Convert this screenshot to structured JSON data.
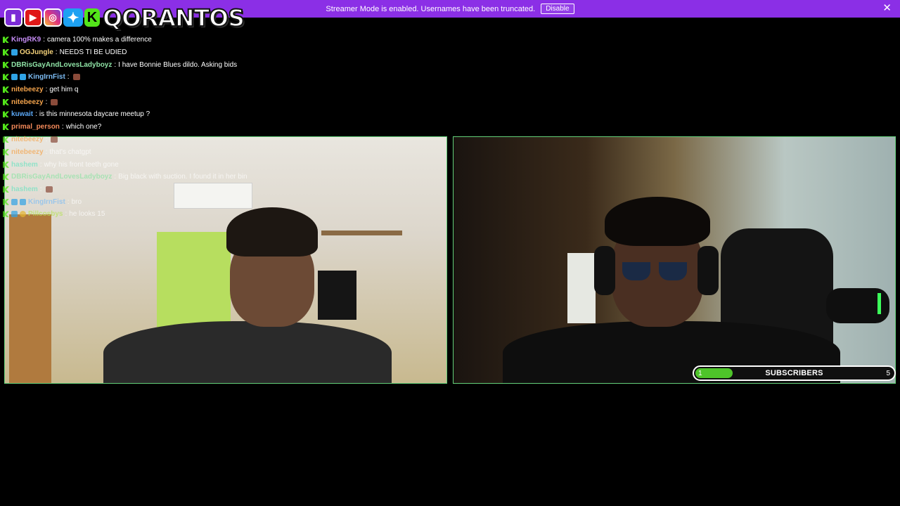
{
  "banner": {
    "message": "Streamer Mode is enabled. Usernames have been truncated.",
    "button_label": "Disable",
    "close_glyph": "✕",
    "color": "#8b2fe6"
  },
  "logo": {
    "name": "QORANTOS",
    "icons": [
      "twitch-icon",
      "youtube-icon",
      "instagram-icon",
      "twitter-icon",
      "kick-icon"
    ]
  },
  "chat_top": [
    {
      "user": "KingRK9",
      "color": "#c58cf5",
      "badges": [
        "kick"
      ],
      "text": "camera 100% makes a difference"
    },
    {
      "user": "OGJungle",
      "color": "#f5d27a",
      "badges": [
        "kick",
        "blue"
      ],
      "text": "NEEDS TI BE UDIED"
    },
    {
      "user": "DBRisGayAndLovesLadyboyz",
      "color": "#8fe3a6",
      "badges": [
        "kick"
      ],
      "text": "I have Bonnie Blues dildo. Asking bids"
    },
    {
      "user": "KingIrnFist",
      "color": "#7dbdf5",
      "badges": [
        "kick",
        "blue",
        "blue"
      ],
      "text": "",
      "emote": true
    },
    {
      "user": "nitebeezy",
      "color": "#f5a44c",
      "badges": [
        "kick"
      ],
      "text": "get him q"
    },
    {
      "user": "nitebeezy",
      "color": "#f5a44c",
      "badges": [
        "kick"
      ],
      "text": "",
      "emote": true
    },
    {
      "user": "kuwait",
      "color": "#5aa7f5",
      "badges": [
        "kick"
      ],
      "text": "is this minnesota daycare meetup ?"
    },
    {
      "user": "primal_person",
      "color": "#f58a5a",
      "badges": [
        "kick"
      ],
      "text": "which one?"
    }
  ],
  "chat_over": [
    {
      "user": "nitebeezy",
      "color": "#f5a44c",
      "badges": [
        "kick"
      ],
      "text": "",
      "emote": true
    },
    {
      "user": "nitebeezy",
      "color": "#f5a44c",
      "badges": [
        "kick"
      ],
      "text": "that's chatgpt"
    },
    {
      "user": "hashem",
      "color": "#6fe3c2",
      "badges": [
        "kick"
      ],
      "text": "why his front teeth gone"
    },
    {
      "user": "DBRisGayAndLovesLadyboyz",
      "color": "#8fe3a6",
      "badges": [
        "kick"
      ],
      "text": "Big black with suction. I found it in her bin"
    },
    {
      "user": "hashem",
      "color": "#6fe3c2",
      "badges": [
        "kick"
      ],
      "text": "",
      "emote": true
    },
    {
      "user": "KingIrnFist",
      "color": "#7dbdf5",
      "badges": [
        "kick",
        "blue",
        "blue"
      ],
      "text": "bro"
    },
    {
      "user": "Pillcosbys",
      "color": "#b7e35a",
      "badges": [
        "kick",
        "blue",
        "gold"
      ],
      "text": "he looks 15"
    }
  ],
  "subscribers": {
    "label": "SUBSCRIBERS",
    "current": 1,
    "goal": 5,
    "progress_fraction": 0.2,
    "color": "#4ec42a"
  }
}
